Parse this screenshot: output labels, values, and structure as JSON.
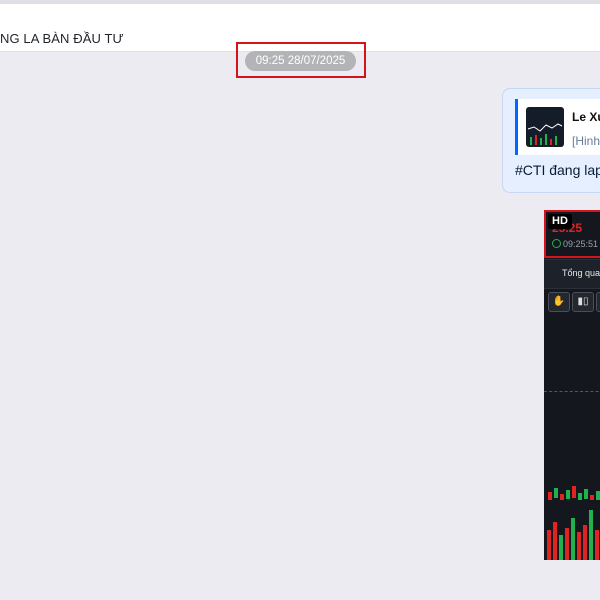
{
  "header": {
    "title": "NG LA BÀN ĐẦU TƯ"
  },
  "chat": {
    "timestamp": "09:25 28/07/2025",
    "message": {
      "quote_name": "Le Xu",
      "quote_subtitle": "[Hinh",
      "text": "#CTI đang lap"
    },
    "image_message": {
      "badge": "HD",
      "price": "25.25",
      "time": "09:25:51",
      "tab_label": "Tổng quan",
      "tool_icons": [
        "hand-icon",
        "candle-icon",
        "more-icon"
      ]
    }
  },
  "colors": {
    "accent": "#0068ff",
    "highlight_box": "#d0161c",
    "bubble_bg": "#e5efff",
    "chart_bg": "#14171e",
    "price_down": "#e02424",
    "price_up": "#22b14c"
  }
}
